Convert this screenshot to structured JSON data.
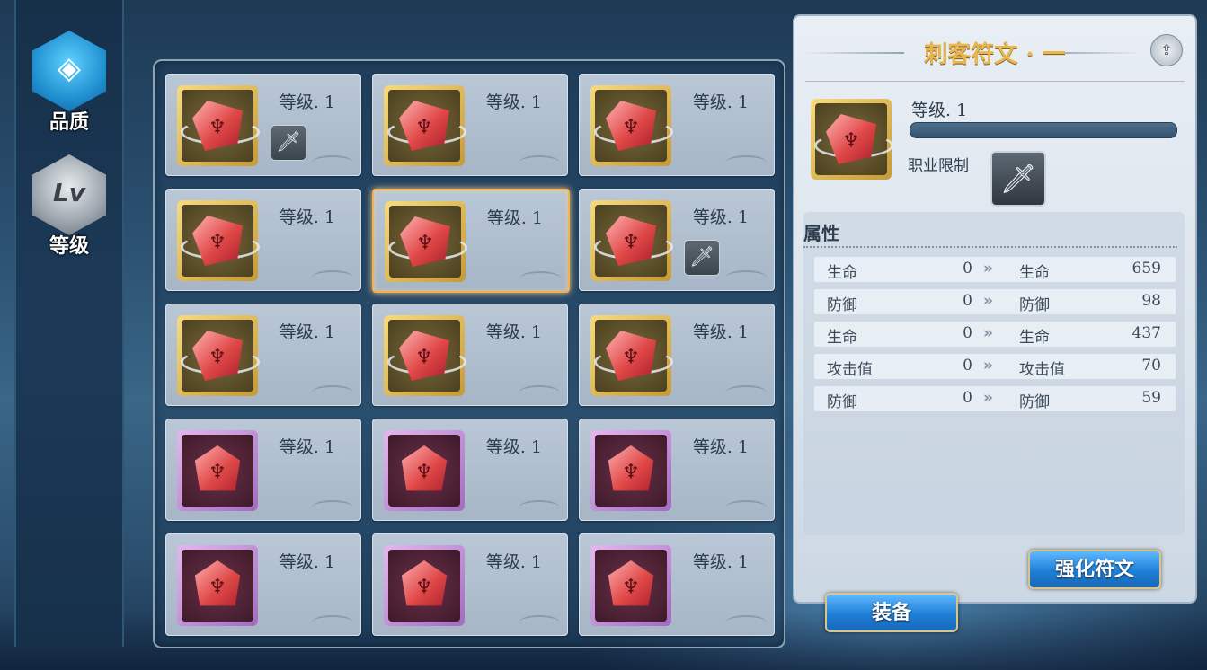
{
  "nav": {
    "quality_label": "品质",
    "level_label": "等级",
    "level_icon_text": "Lv"
  },
  "grid": {
    "level_text": "等级. 1",
    "cells": [
      {
        "rarity": "gold",
        "has_class_badge": true,
        "selected": false
      },
      {
        "rarity": "gold",
        "has_class_badge": false,
        "selected": false
      },
      {
        "rarity": "gold",
        "has_class_badge": false,
        "selected": false
      },
      {
        "rarity": "gold",
        "has_class_badge": false,
        "selected": false
      },
      {
        "rarity": "gold",
        "has_class_badge": false,
        "selected": true
      },
      {
        "rarity": "gold",
        "has_class_badge": true,
        "selected": false
      },
      {
        "rarity": "gold",
        "has_class_badge": false,
        "selected": false
      },
      {
        "rarity": "gold",
        "has_class_badge": false,
        "selected": false
      },
      {
        "rarity": "gold",
        "has_class_badge": false,
        "selected": false
      },
      {
        "rarity": "purple",
        "has_class_badge": false,
        "selected": false
      },
      {
        "rarity": "purple",
        "has_class_badge": false,
        "selected": false
      },
      {
        "rarity": "purple",
        "has_class_badge": false,
        "selected": false
      },
      {
        "rarity": "purple",
        "has_class_badge": false,
        "selected": false
      },
      {
        "rarity": "purple",
        "has_class_badge": false,
        "selected": false
      },
      {
        "rarity": "purple",
        "has_class_badge": false,
        "selected": false
      }
    ]
  },
  "detail": {
    "title": "刺客符文 · 一",
    "level_text": "等级. 1",
    "exp_progress": 0,
    "job_restriction_label": "职业限制",
    "attributes_title": "属性",
    "attributes": [
      {
        "name": "生命",
        "current": "0",
        "next_name": "生命",
        "next": "659"
      },
      {
        "name": "防御",
        "current": "0",
        "next_name": "防御",
        "next": "98"
      },
      {
        "name": "生命",
        "current": "0",
        "next_name": "生命",
        "next": "437"
      },
      {
        "name": "攻击值",
        "current": "0",
        "next_name": "攻击值",
        "next": "70"
      },
      {
        "name": "防御",
        "current": "0",
        "next_name": "防御",
        "next": "59"
      }
    ]
  },
  "buttons": {
    "enhance": "强化符文",
    "equip": "装备"
  },
  "colors": {
    "title_gold": "#e8b64d",
    "selected_border": "#f0b257",
    "gold_frame": "#f7db7c",
    "purple_frame": "#e5b7ef",
    "gem_red": "#e04848",
    "button_blue": "#1f7fd8"
  },
  "icons": {
    "quality_nav": "diamond-icon",
    "level_nav": "lv-icon",
    "class_badge": "dagger-icon",
    "share": "share-icon",
    "arrow": "double-chevron-right-icon"
  }
}
